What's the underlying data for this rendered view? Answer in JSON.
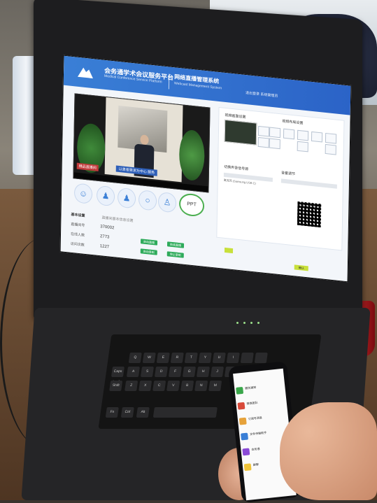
{
  "screen": {
    "brand_title": "会务通学术会议服务平台",
    "brand_subtitle": "Medical Conference Service Platform",
    "system_title": "网络直播管理系统",
    "system_subtitle": "Webcast Management System",
    "header_right": "退出登录   系统管理员",
    "video_tag": "精品直播间",
    "video_caption": "以患者需求为中心 服务",
    "ppt_label": "PPT",
    "panel_title": "视频画面设置",
    "panel_title2": "视频布局设置",
    "panel_label": "切换声音信号源",
    "panel_label2": "音量调节",
    "panel_value": "麦克风 (Samsung USB C)",
    "settings_title": "基本设置",
    "settings_subtitle": "直播间基本信息设置",
    "rows": [
      {
        "label": "直播间号",
        "value": "370002"
      },
      {
        "label": "在线人数",
        "value": "2773"
      },
      {
        "label": "访问次数",
        "value": "1227"
      }
    ],
    "buttons": [
      "启动直播",
      "结束直播",
      "启动录制",
      "停止录制",
      "确认"
    ]
  },
  "phone": {
    "items": [
      "服务通知",
      "微信团队",
      "订阅号消息",
      "文件传输助手",
      "会务通",
      "群聊"
    ]
  },
  "keyboard": {
    "keys": [
      "Caps Lock",
      "Shift",
      "Fn",
      "Ctrl",
      "Alt",
      "Z",
      "X",
      "C",
      "V",
      "B",
      "N",
      "M",
      "A",
      "S",
      "D",
      "F",
      "G",
      "H",
      "J",
      "K",
      "Q",
      "W",
      "E",
      "R",
      "T",
      "Y",
      "U",
      "I"
    ]
  }
}
